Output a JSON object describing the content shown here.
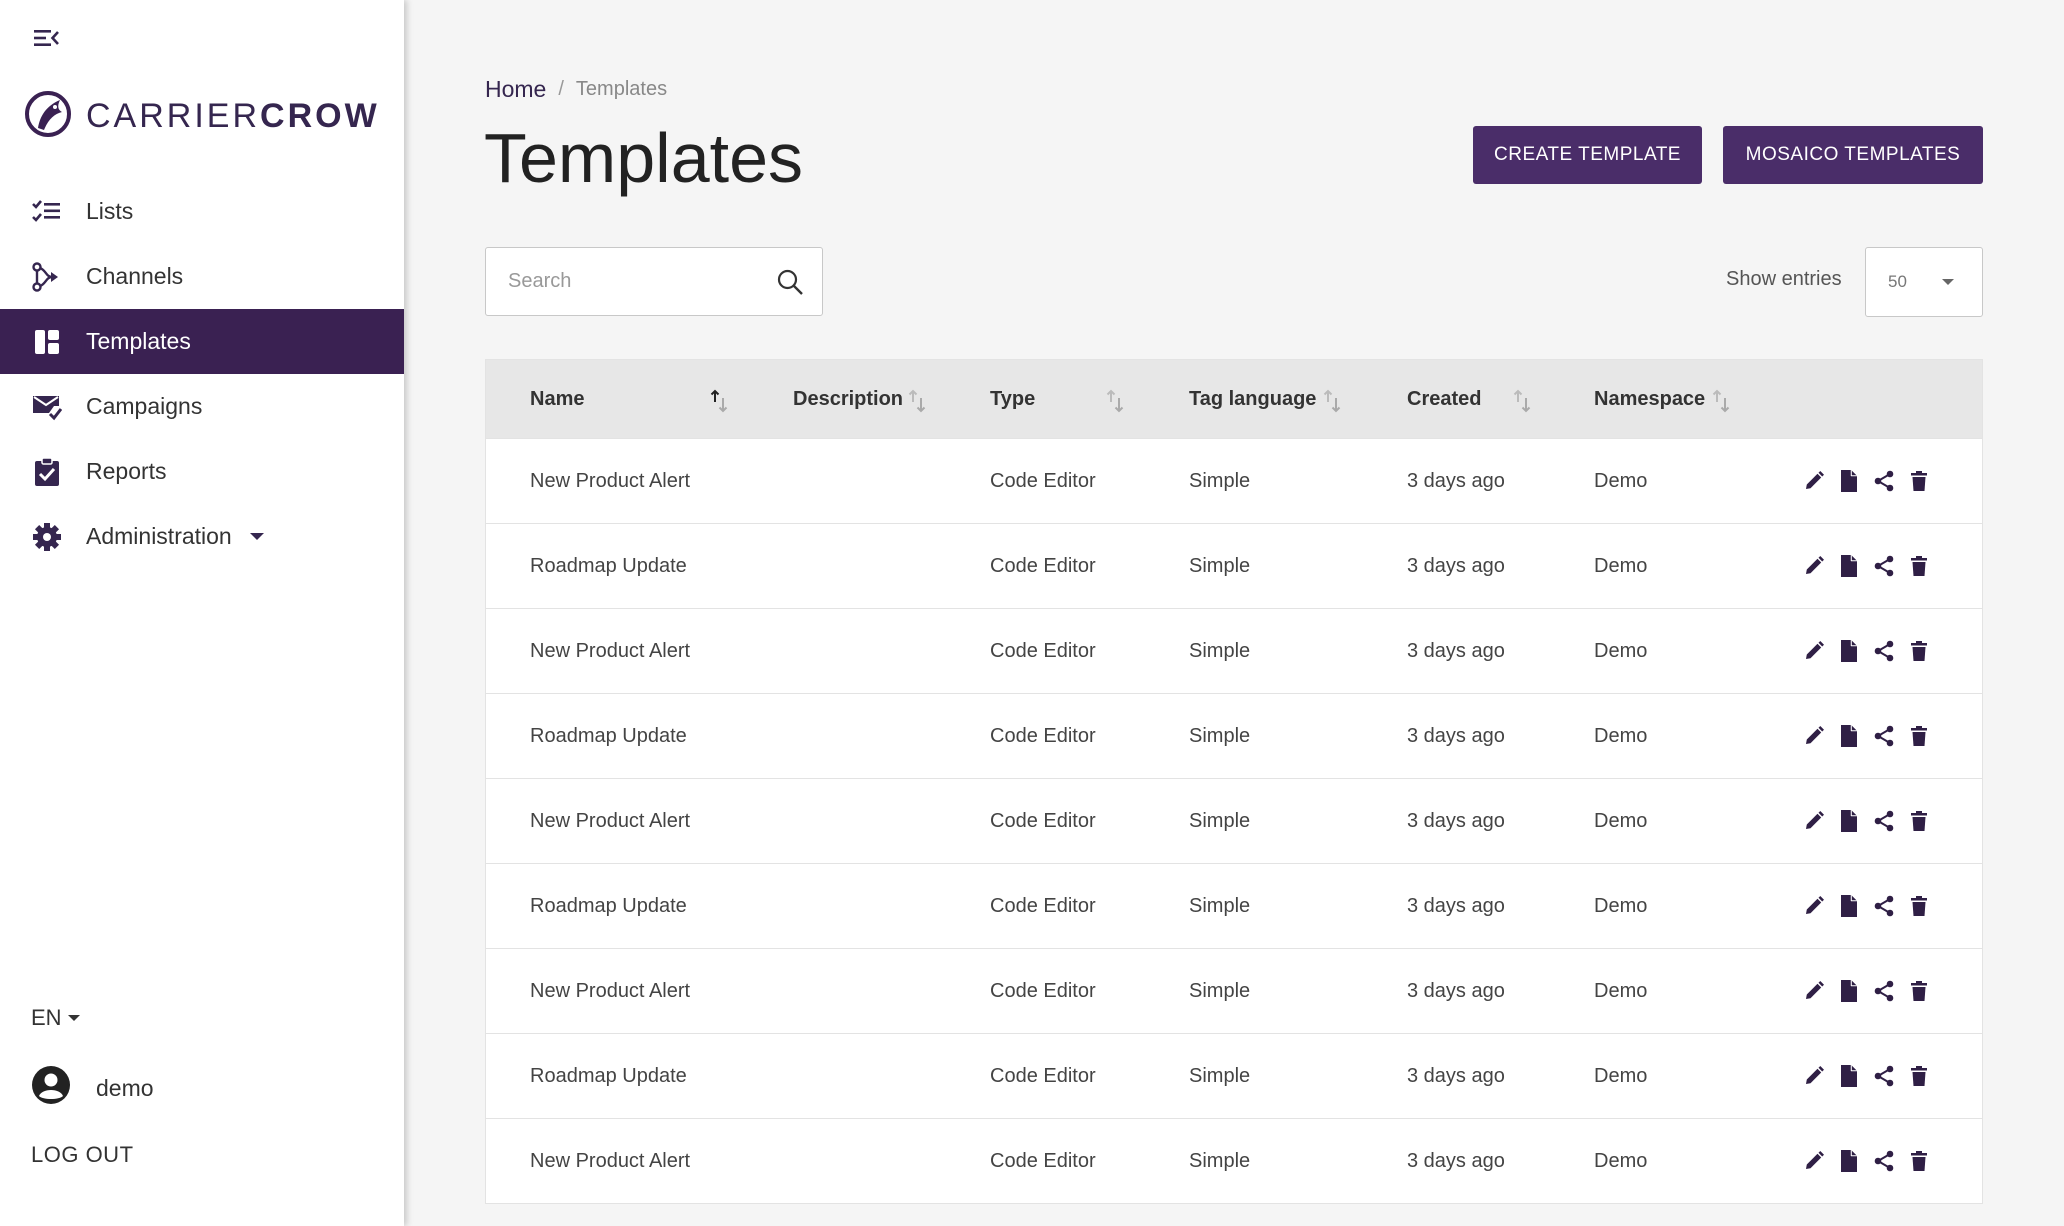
{
  "brand": {
    "name_light": "CARRIER",
    "name_bold": "CROW",
    "color": "#3a2152"
  },
  "sidebar": {
    "items": [
      {
        "label": "Lists",
        "icon": "checklist-icon"
      },
      {
        "label": "Channels",
        "icon": "channels-icon"
      },
      {
        "label": "Templates",
        "icon": "templates-icon",
        "active": true
      },
      {
        "label": "Campaigns",
        "icon": "campaign-mail-icon"
      },
      {
        "label": "Reports",
        "icon": "report-check-icon"
      },
      {
        "label": "Administration",
        "icon": "gear-icon"
      }
    ],
    "language": "EN",
    "username": "demo",
    "logout": "LOG OUT"
  },
  "breadcrumb": {
    "home": "Home",
    "separator": "/",
    "current": "Templates"
  },
  "page_title": "Templates",
  "toolbar": {
    "create_label": "CREATE TEMPLATE",
    "mosaico_label": "MOSAICO TEMPLATES"
  },
  "search": {
    "placeholder": "Search",
    "value": ""
  },
  "entries": {
    "label": "Show entries",
    "value": "50"
  },
  "table": {
    "headers": {
      "name": "Name",
      "description": "Description",
      "type": "Type",
      "tag_language": "Tag language",
      "created": "Created",
      "namespace": "Namespace"
    },
    "rows": [
      {
        "name": "New Product Alert",
        "description": "",
        "type": "Code Editor",
        "tag_language": "Simple",
        "created": "3 days ago",
        "namespace": "Demo"
      },
      {
        "name": "Roadmap Update",
        "description": "",
        "type": "Code Editor",
        "tag_language": "Simple",
        "created": "3 days ago",
        "namespace": "Demo"
      },
      {
        "name": "New Product Alert",
        "description": "",
        "type": "Code Editor",
        "tag_language": "Simple",
        "created": "3 days ago",
        "namespace": "Demo"
      },
      {
        "name": "Roadmap Update",
        "description": "",
        "type": "Code Editor",
        "tag_language": "Simple",
        "created": "3 days ago",
        "namespace": "Demo"
      },
      {
        "name": "New Product Alert",
        "description": "",
        "type": "Code Editor",
        "tag_language": "Simple",
        "created": "3 days ago",
        "namespace": "Demo"
      },
      {
        "name": "Roadmap Update",
        "description": "",
        "type": "Code Editor",
        "tag_language": "Simple",
        "created": "3 days ago",
        "namespace": "Demo"
      },
      {
        "name": "New Product Alert",
        "description": "",
        "type": "Code Editor",
        "tag_language": "Simple",
        "created": "3 days ago",
        "namespace": "Demo"
      },
      {
        "name": "Roadmap Update",
        "description": "",
        "type": "Code Editor",
        "tag_language": "Simple",
        "created": "3 days ago",
        "namespace": "Demo"
      },
      {
        "name": "New Product Alert",
        "description": "",
        "type": "Code Editor",
        "tag_language": "Simple",
        "created": "3 days ago",
        "namespace": "Demo"
      }
    ]
  },
  "row_actions": [
    "edit-icon",
    "duplicate-icon",
    "share-icon",
    "delete-icon"
  ]
}
